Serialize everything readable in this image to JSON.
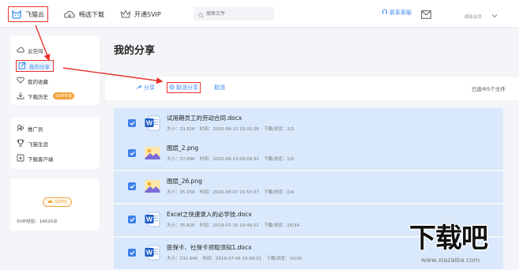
{
  "header": {
    "nav": [
      {
        "label": "飞猫云",
        "icon": "cat-logo-icon"
      },
      {
        "label": "畅选下载",
        "icon": "cloud-download-icon"
      },
      {
        "label": "开通SVIP",
        "icon": "crown-icon"
      }
    ],
    "search_placeholder": "搜索文件",
    "contact_label": "联系客服",
    "account_label": "超级会员"
  },
  "sidebar": {
    "group1": [
      {
        "label": "云空间",
        "icon": "cloud-icon"
      },
      {
        "label": "我的分享",
        "icon": "share-icon"
      },
      {
        "label": "我的收藏",
        "icon": "heart-icon"
      },
      {
        "label": "下载历史",
        "icon": "download-icon",
        "tag": "SVIP专享"
      }
    ],
    "group2": [
      {
        "label": "推广员",
        "icon": "promoter-icon"
      },
      {
        "label": "飞猫生涯",
        "icon": "trophy-icon"
      },
      {
        "label": "下载客户端",
        "icon": "client-icon"
      }
    ],
    "svip_badge": "SVIP6",
    "svip_exp": "SVIP经验：14520点"
  },
  "main": {
    "title": "我的分享",
    "toolbar": {
      "share_label": "分享",
      "cancel_share_label": "取消分享",
      "cancel_label": "取消",
      "selected_count": "已选中5个文件"
    },
    "meta_labels": {
      "size": "大小：",
      "time": "时间：",
      "stats": "下载/浏览："
    },
    "files": [
      {
        "name": "试用期员工的劳动合同.docx",
        "size": "13.81K",
        "time": "2020-08-13 15:05:28",
        "stats": "2/3",
        "type": "word"
      },
      {
        "name": "图层_2.png",
        "size": "37.89K",
        "time": "2020-08-13 09:09:32",
        "stats": "1/0",
        "type": "image"
      },
      {
        "name": "图层_26.png",
        "size": "35.55K",
        "time": "2020-08-07 15:53:37",
        "stats": "0/4",
        "type": "image"
      },
      {
        "name": "Excel之快速录入的必学技.docx",
        "size": "35.82K",
        "time": "2019-07-18 10:49:22",
        "stats": "26/34",
        "type": "word"
      },
      {
        "name": "医保卡、社保卡领取须知1.docx",
        "size": "231.64K",
        "time": "2019-07-04 16:58:01",
        "stats": "10/20",
        "type": "word"
      }
    ]
  },
  "watermark": {
    "main": "下载吧",
    "url": "www.xiazaiba.com"
  },
  "colors": {
    "accent": "#3c8cf0",
    "annotation": "#e8322d",
    "row_selected": "#d9e9fb",
    "svip": "#f2a33a"
  }
}
